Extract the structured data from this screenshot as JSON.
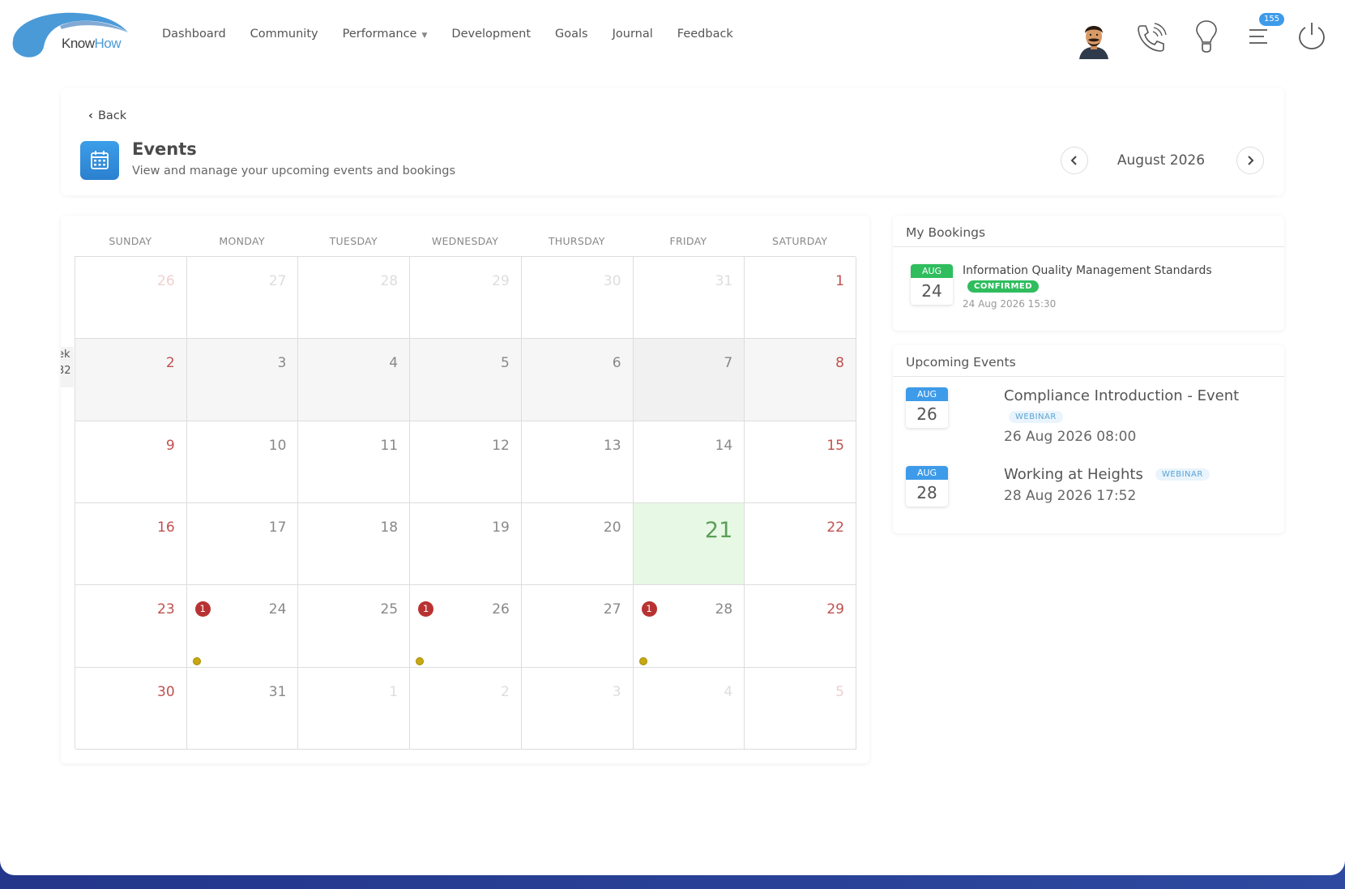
{
  "app": {
    "logo_know": "Know",
    "logo_how": "How",
    "accent_color": "#3d9be9",
    "notification_count": "155"
  },
  "nav": {
    "items": [
      {
        "label": "Dashboard"
      },
      {
        "label": "Community"
      },
      {
        "label": "Performance",
        "has_dropdown": true
      },
      {
        "label": "Development"
      },
      {
        "label": "Goals"
      },
      {
        "label": "Journal"
      },
      {
        "label": "Feedback"
      }
    ],
    "icons": [
      "avatar",
      "phone-icon",
      "lightbulb-icon",
      "menu-icon",
      "power-icon"
    ]
  },
  "header": {
    "back_label": "Back",
    "title": "Events",
    "subtitle": "View and manage your upcoming events and bookings",
    "month_label": "August 2026"
  },
  "calendar": {
    "days_of_week": [
      "SUNDAY",
      "MONDAY",
      "TUESDAY",
      "WEDNESDAY",
      "THURSDAY",
      "FRIDAY",
      "SATURDAY"
    ],
    "week_label": [
      "ek",
      "32"
    ],
    "today": "21",
    "weeks": [
      [
        "26",
        "27",
        "28",
        "29",
        "30",
        "31",
        "1"
      ],
      [
        "2",
        "3",
        "4",
        "5",
        "6",
        "7",
        "8"
      ],
      [
        "9",
        "10",
        "11",
        "12",
        "13",
        "14",
        "15"
      ],
      [
        "16",
        "17",
        "18",
        "19",
        "20",
        "21",
        "22"
      ],
      [
        "23",
        "24",
        "25",
        "26",
        "27",
        "28",
        "29"
      ],
      [
        "30",
        "31",
        "1",
        "2",
        "3",
        "4",
        "5"
      ]
    ],
    "event_counts": {
      "24": "1",
      "26": "1",
      "28": "1"
    }
  },
  "bookings": {
    "title": "My Bookings",
    "items": [
      {
        "month": "AUG",
        "day": "24",
        "name": "Information Quality Management Standards",
        "status": "CONFIRMED",
        "when": "24 Aug 2026 15:30"
      }
    ]
  },
  "upcoming": {
    "title": "Upcoming Events",
    "items": [
      {
        "month": "AUG",
        "day": "26",
        "name": "Compliance Introduction - Event",
        "type": "WEBINAR",
        "when": "26 Aug 2026 08:00"
      },
      {
        "month": "AUG",
        "day": "28",
        "name": "Working at Heights",
        "type": "WEBINAR",
        "when": "28 Aug 2026 17:52"
      }
    ]
  }
}
